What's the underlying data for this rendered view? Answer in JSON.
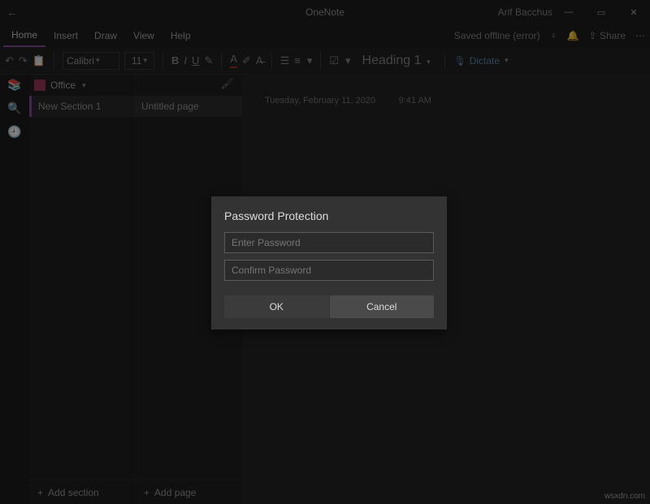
{
  "titlebar": {
    "app_name": "OneNote",
    "user_name": "Arif Bacchus"
  },
  "menu": {
    "tabs": [
      "Home",
      "Insert",
      "Draw",
      "View",
      "Help"
    ],
    "active_index": 0,
    "sync_status": "Saved offline (error)",
    "share_label": "Share"
  },
  "ribbon": {
    "font_name": "Calibri",
    "font_size": "11",
    "style_label": "Heading 1",
    "dictate_label": "Dictate"
  },
  "notebook": {
    "name": "Office",
    "section": "New Section 1",
    "page": "Untitled page",
    "add_section_label": "Add section",
    "add_page_label": "Add page"
  },
  "canvas": {
    "date": "Tuesday, February 11, 2020",
    "time": "9:41 AM"
  },
  "dialog": {
    "title": "Password Protection",
    "password_placeholder": "Enter Password",
    "confirm_placeholder": "Confirm Password",
    "ok_label": "OK",
    "cancel_label": "Cancel"
  },
  "watermark": "wsxdn.com"
}
